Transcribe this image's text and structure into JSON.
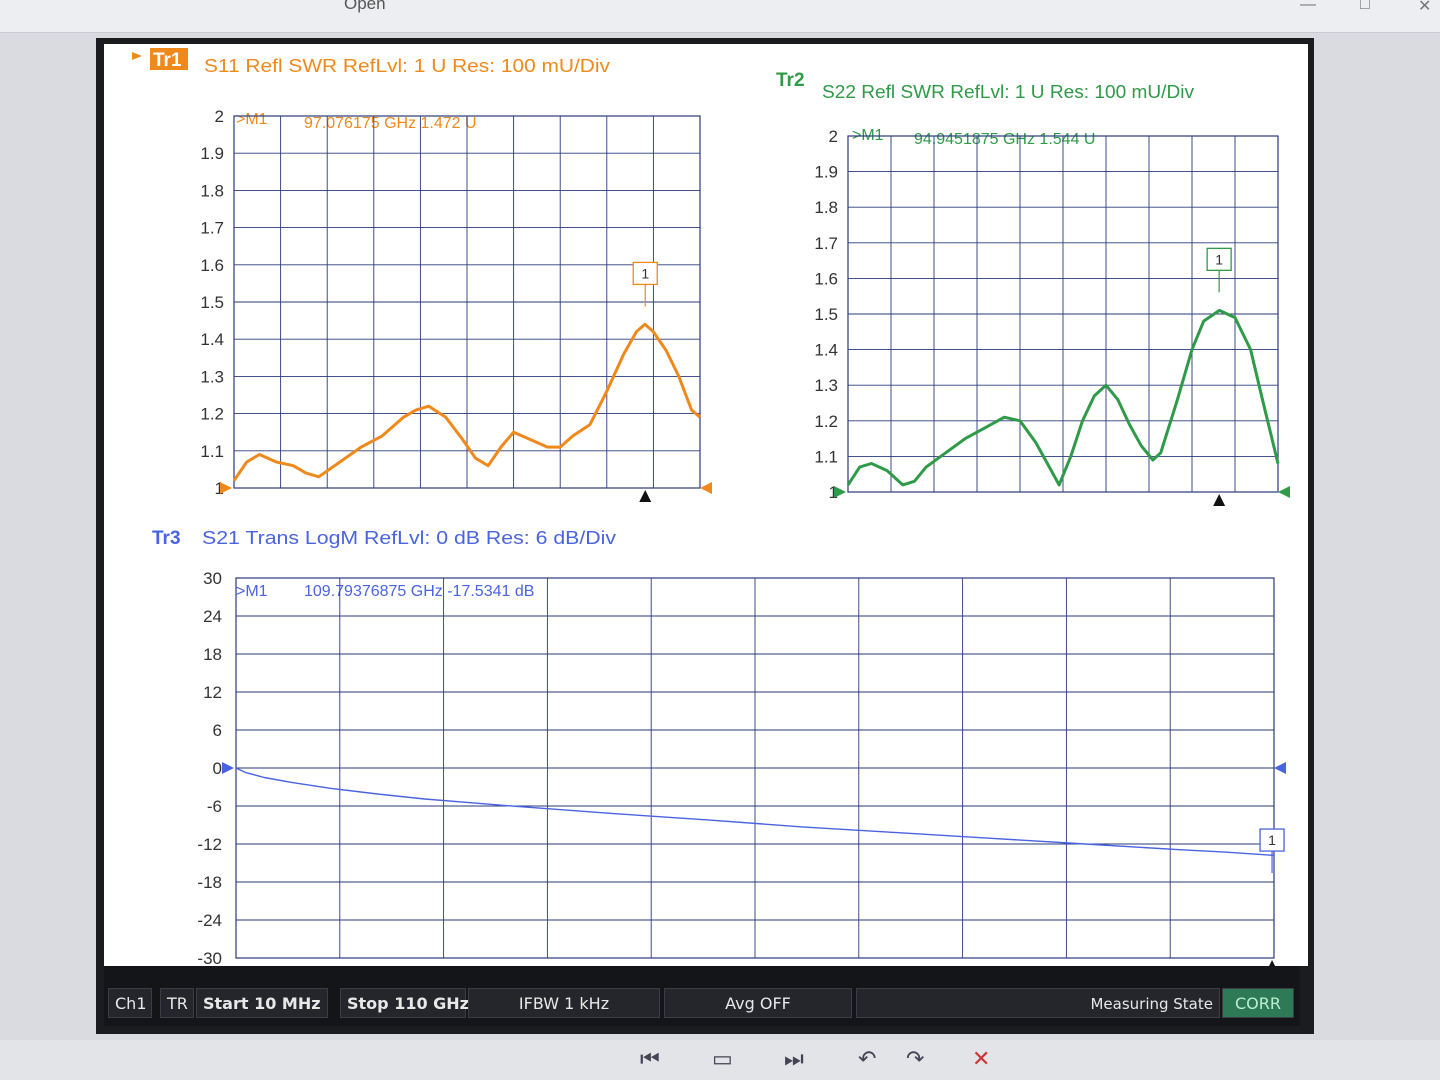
{
  "app": {
    "menu_items": [
      "Open"
    ],
    "window_controls": [
      "—",
      "□",
      "✕"
    ]
  },
  "colors": {
    "tr1": "#f0891c",
    "tr2": "#2f9a48",
    "tr3": "#4a63e0",
    "grid": "#2a3a7a",
    "axis_text": "#333333",
    "corr_bg": "#2f7a56"
  },
  "traces": {
    "tr1": {
      "tag": "Tr1",
      "header": "S11 Refl SWR RefLvl: 1  U Res: 100 mU/Div",
      "marker_label": ">M1",
      "marker_readout": "97.076175 GHz  1.472  U",
      "marker_number": "1",
      "y_ticks": [
        "2",
        "1.9",
        "1.8",
        "1.7",
        "1.6",
        "1.5",
        "1.4",
        "1.3",
        "1.2",
        "1.1",
        "1"
      ]
    },
    "tr2": {
      "tag": "Tr2",
      "header": "S22 Refl SWR RefLvl: 1  U Res: 100 mU/Div",
      "marker_label": ">M1",
      "marker_readout": "94.9451875 GHz  1.544  U",
      "marker_number": "1",
      "y_ticks": [
        "2",
        "1.9",
        "1.8",
        "1.7",
        "1.6",
        "1.5",
        "1.4",
        "1.3",
        "1.2",
        "1.1",
        "1"
      ]
    },
    "tr3": {
      "tag": "Tr3",
      "header": "S21 Trans LogM RefLvl: 0  dB Res: 6  dB/Div",
      "marker_label": ">M1",
      "marker_readout": "109.79376875 GHz  -17.5341  dB",
      "marker_number": "1",
      "y_ticks": [
        "30",
        "24",
        "18",
        "12",
        "6",
        "0",
        "-6",
        "-12",
        "-18",
        "-24",
        "-30"
      ]
    }
  },
  "status": {
    "channel": "Ch1",
    "tr": "TR",
    "start": "Start 10 MHz",
    "stop": "Stop 110 GHz",
    "ifbw": "IFBW 1 kHz",
    "avg": "Avg OFF",
    "state": "Measuring State",
    "corr": "CORR"
  },
  "chart_data": [
    {
      "type": "line",
      "trace": "Tr1",
      "parameter": "S11",
      "unit": "U",
      "x_unit": "GHz",
      "xlim": [
        0.01,
        110
      ],
      "ylim": [
        1,
        2
      ],
      "grid": true,
      "marker": {
        "x": 97.076175,
        "y": 1.472
      },
      "series": [
        {
          "x": [
            0.01,
            3,
            6,
            10,
            14,
            17,
            20,
            25,
            30,
            35,
            40,
            43,
            46,
            50,
            54,
            57,
            60,
            63,
            66,
            70,
            74,
            77,
            80,
            84,
            88,
            92,
            95,
            97,
            99,
            102,
            105,
            108,
            110
          ],
          "values": [
            1.02,
            1.07,
            1.09,
            1.07,
            1.06,
            1.04,
            1.03,
            1.07,
            1.11,
            1.14,
            1.19,
            1.21,
            1.22,
            1.19,
            1.13,
            1.08,
            1.06,
            1.11,
            1.15,
            1.13,
            1.11,
            1.11,
            1.14,
            1.17,
            1.26,
            1.36,
            1.42,
            1.44,
            1.42,
            1.37,
            1.3,
            1.21,
            1.19
          ]
        }
      ]
    },
    {
      "type": "line",
      "trace": "Tr2",
      "parameter": "S22",
      "unit": "U",
      "x_unit": "GHz",
      "xlim": [
        0.01,
        110
      ],
      "ylim": [
        1,
        2
      ],
      "grid": true,
      "marker": {
        "x": 94.9451875,
        "y": 1.544
      },
      "series": [
        {
          "x": [
            0.01,
            3,
            6,
            10,
            14,
            17,
            20,
            25,
            30,
            35,
            40,
            44,
            48,
            52,
            54,
            57,
            60,
            63,
            66,
            69,
            72,
            75,
            78,
            80,
            84,
            88,
            91,
            95,
            99,
            103,
            106,
            110
          ],
          "values": [
            1.02,
            1.07,
            1.08,
            1.06,
            1.02,
            1.03,
            1.07,
            1.11,
            1.15,
            1.18,
            1.21,
            1.2,
            1.14,
            1.06,
            1.02,
            1.1,
            1.2,
            1.27,
            1.3,
            1.26,
            1.19,
            1.13,
            1.09,
            1.11,
            1.25,
            1.4,
            1.48,
            1.51,
            1.49,
            1.4,
            1.26,
            1.08
          ]
        }
      ]
    },
    {
      "type": "line",
      "trace": "Tr3",
      "parameter": "S21",
      "unit": "dB",
      "x_unit": "GHz",
      "xlim": [
        0.01,
        110
      ],
      "ylim": [
        -30,
        30
      ],
      "grid": true,
      "marker": {
        "x": 109.79376875,
        "y": -17.5341
      },
      "series": [
        {
          "x": [
            0.01,
            1,
            3,
            6,
            10,
            15,
            20,
            25,
            30,
            40,
            50,
            60,
            70,
            80,
            90,
            100,
            105,
            110
          ],
          "values": [
            0,
            -0.7,
            -1.5,
            -2.3,
            -3.2,
            -4.1,
            -4.9,
            -5.5,
            -6.1,
            -7.2,
            -8.2,
            -9.3,
            -10.2,
            -11.1,
            -12.0,
            -12.9,
            -13.3,
            -13.8
          ]
        }
      ]
    }
  ]
}
